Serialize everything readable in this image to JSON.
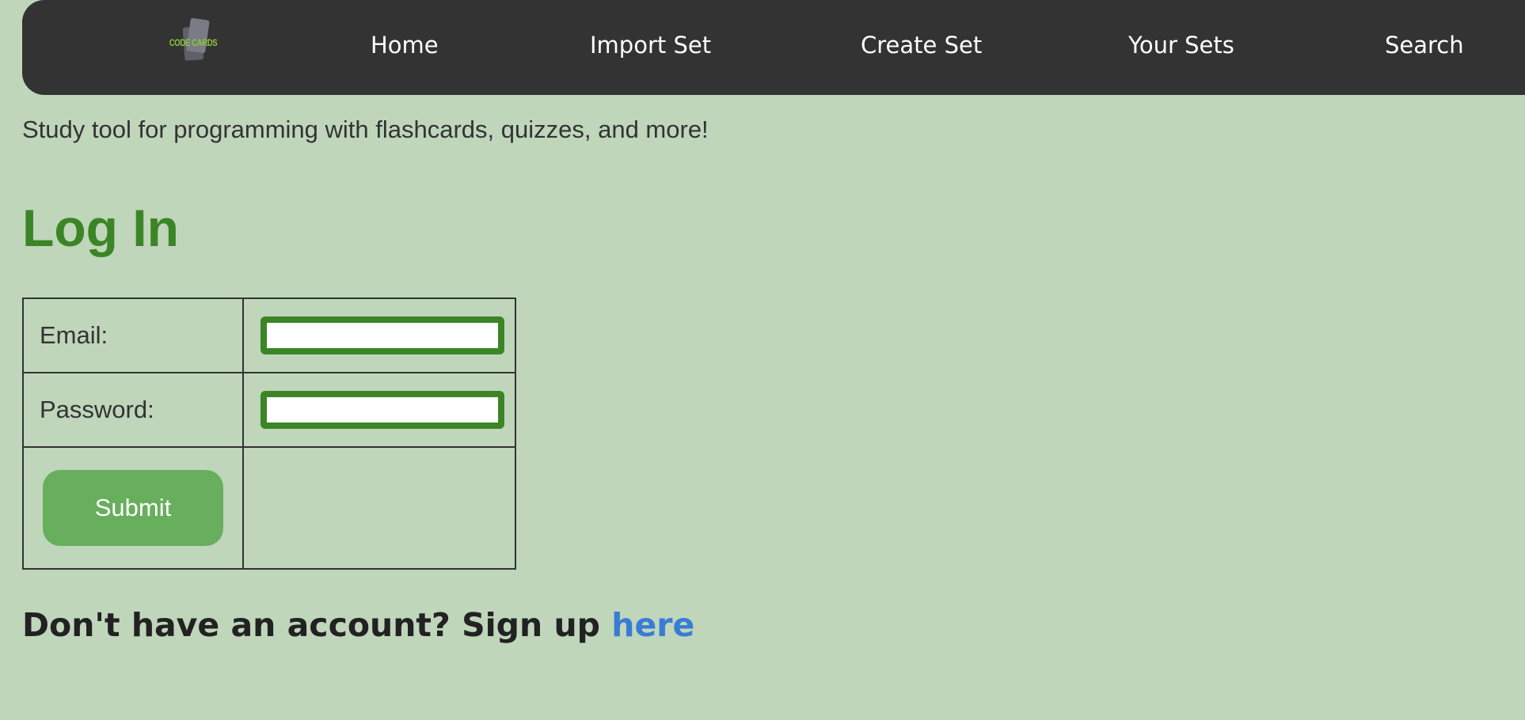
{
  "nav": {
    "logo_text": "CODE CARDS",
    "items": [
      {
        "label": "Home"
      },
      {
        "label": "Import Set"
      },
      {
        "label": "Create Set"
      },
      {
        "label": "Your Sets"
      },
      {
        "label": "Search"
      }
    ]
  },
  "tagline": "Study tool for programming with flashcards, quizzes, and more!",
  "login": {
    "title": "Log In",
    "email_label": "Email:",
    "email_value": "",
    "password_label": "Password:",
    "password_value": "",
    "submit_label": "Submit"
  },
  "signup": {
    "prompt": "Don't have an account? Sign up ",
    "link_label": "here"
  },
  "colors": {
    "background": "#bfd6bb",
    "navbar": "#333333",
    "accent_green": "#3b8526",
    "button_green": "#68af5d",
    "link_blue": "#3a7bd5"
  }
}
